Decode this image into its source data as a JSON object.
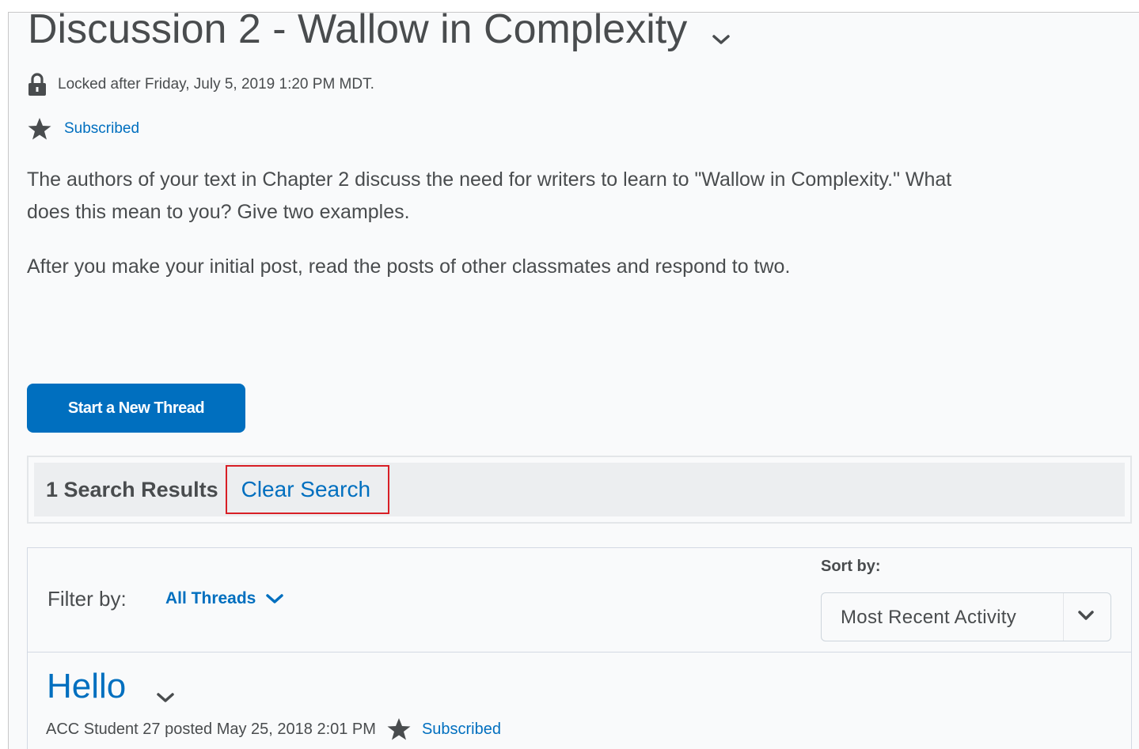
{
  "topic": {
    "title": "Discussion 2 - Wallow in Complexity",
    "lock_text": "Locked after Friday, July 5, 2019 1:20 PM MDT.",
    "subscribe_label": "Subscribed",
    "paragraphs": [
      "The authors of your text in Chapter 2 discuss the need for writers to learn to \"Wallow in Complexity.\"  What does this mean to you?  Give two examples.",
      "After you make your initial post, read the posts of other classmates and respond to two."
    ]
  },
  "actions": {
    "start_thread_label": "Start a New Thread"
  },
  "search": {
    "results_text": "1 Search Results",
    "clear_label": "Clear Search"
  },
  "filter": {
    "label": "Filter by:",
    "value": "All Threads"
  },
  "sort": {
    "label": "Sort by:",
    "value": "Most Recent Activity"
  },
  "threads": [
    {
      "title": "Hello",
      "posted_text": "ACC Student 27 posted May 25, 2018 2:01 PM",
      "subscribe_label": "Subscribed"
    }
  ],
  "colors": {
    "link": "#006fbf",
    "primary_button": "#006fbf",
    "highlight_border": "#d81f26",
    "text": "#494c4e"
  }
}
